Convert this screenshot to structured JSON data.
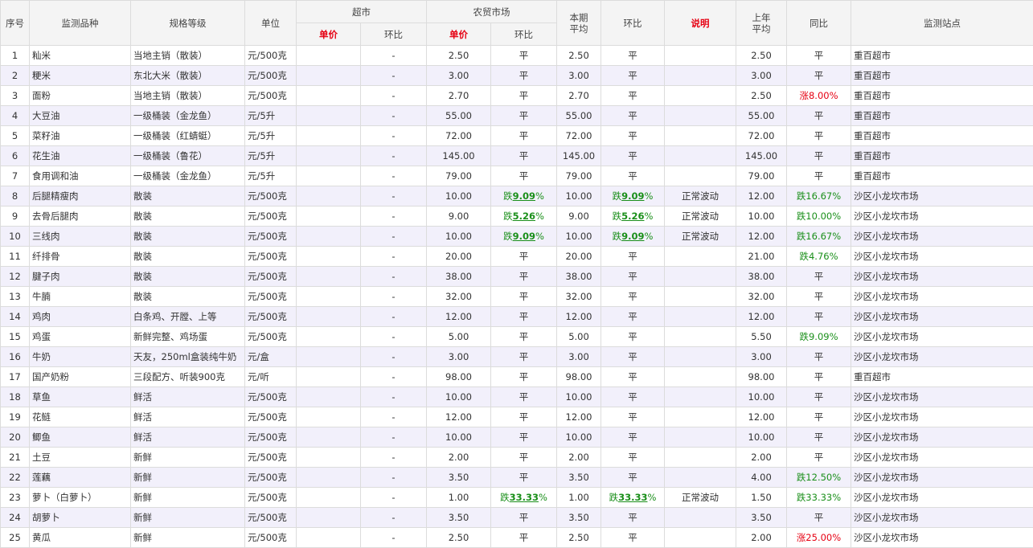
{
  "header": {
    "no": "序号",
    "variety": "监测品种",
    "spec": "规格等级",
    "unit": "单位",
    "supermarket": "超市",
    "farmers_market": "农贸市场",
    "avg_line1": "本期",
    "avg_line2": "平均",
    "mom": "环比",
    "note": "说明",
    "last_line1": "上年",
    "last_line2": "平均",
    "yoy": "同比",
    "station": "监测站点",
    "price": "单价",
    "change": "环比"
  },
  "rows": [
    {
      "no": "1",
      "name": "籼米",
      "spec": "当地主销（散装）",
      "unit": "元/500克",
      "sp": "",
      "sc": "-",
      "fp": "2.50",
      "fc": {
        "text": "平"
      },
      "avg": "2.50",
      "mom": {
        "text": "平"
      },
      "note": "",
      "last": "2.50",
      "yoy": {
        "text": "平"
      },
      "station": "重百超市"
    },
    {
      "no": "2",
      "name": "粳米",
      "spec": "东北大米（散装）",
      "unit": "元/500克",
      "sp": "",
      "sc": "-",
      "fp": "3.00",
      "fc": {
        "text": "平"
      },
      "avg": "3.00",
      "mom": {
        "text": "平"
      },
      "note": "",
      "last": "3.00",
      "yoy": {
        "text": "平"
      },
      "station": "重百超市"
    },
    {
      "no": "3",
      "name": "面粉",
      "spec": "当地主销（散装）",
      "unit": "元/500克",
      "sp": "",
      "sc": "-",
      "fp": "2.70",
      "fc": {
        "text": "平"
      },
      "avg": "2.70",
      "mom": {
        "text": "平"
      },
      "note": "",
      "last": "2.50",
      "yoy": {
        "dir": "up",
        "text": "涨8.00%"
      },
      "station": "重百超市"
    },
    {
      "no": "4",
      "name": "大豆油",
      "spec": "一级桶装（金龙鱼）",
      "unit": "元/5升",
      "sp": "",
      "sc": "-",
      "fp": "55.00",
      "fc": {
        "text": "平"
      },
      "avg": "55.00",
      "mom": {
        "text": "平"
      },
      "note": "",
      "last": "55.00",
      "yoy": {
        "text": "平"
      },
      "station": "重百超市"
    },
    {
      "no": "5",
      "name": "菜籽油",
      "spec": "一级桶装（红蜻蜓）",
      "unit": "元/5升",
      "sp": "",
      "sc": "-",
      "fp": "72.00",
      "fc": {
        "text": "平"
      },
      "avg": "72.00",
      "mom": {
        "text": "平"
      },
      "note": "",
      "last": "72.00",
      "yoy": {
        "text": "平"
      },
      "station": "重百超市"
    },
    {
      "no": "6",
      "name": "花生油",
      "spec": "一级桶装（鲁花）",
      "unit": "元/5升",
      "sp": "",
      "sc": "-",
      "fp": "145.00",
      "fc": {
        "text": "平"
      },
      "avg": "145.00",
      "mom": {
        "text": "平"
      },
      "note": "",
      "last": "145.00",
      "yoy": {
        "text": "平"
      },
      "station": "重百超市"
    },
    {
      "no": "7",
      "name": "食用调和油",
      "spec": "一级桶装（金龙鱼）",
      "unit": "元/5升",
      "sp": "",
      "sc": "-",
      "fp": "79.00",
      "fc": {
        "text": "平"
      },
      "avg": "79.00",
      "mom": {
        "text": "平"
      },
      "note": "",
      "last": "79.00",
      "yoy": {
        "text": "平"
      },
      "station": "重百超市"
    },
    {
      "no": "8",
      "name": "后腿精瘦肉",
      "spec": "散装",
      "unit": "元/500克",
      "sp": "",
      "sc": "-",
      "fp": "10.00",
      "fc": {
        "dir": "down",
        "pre": "跌",
        "num": "9.09",
        "post": "%"
      },
      "avg": "10.00",
      "mom": {
        "dir": "down",
        "pre": "跌",
        "num": "9.09",
        "post": "%"
      },
      "note": "正常波动",
      "last": "12.00",
      "yoy": {
        "dir": "down",
        "text": "跌16.67%"
      },
      "station": "沙区小龙坎市场"
    },
    {
      "no": "9",
      "name": "去骨后腿肉",
      "spec": "散装",
      "unit": "元/500克",
      "sp": "",
      "sc": "-",
      "fp": "9.00",
      "fc": {
        "dir": "down",
        "pre": "跌",
        "num": "5.26",
        "post": "%"
      },
      "avg": "9.00",
      "mom": {
        "dir": "down",
        "pre": "跌",
        "num": "5.26",
        "post": "%"
      },
      "note": "正常波动",
      "last": "10.00",
      "yoy": {
        "dir": "down",
        "text": "跌10.00%"
      },
      "station": "沙区小龙坎市场"
    },
    {
      "no": "10",
      "name": "三线肉",
      "spec": "散装",
      "unit": "元/500克",
      "sp": "",
      "sc": "-",
      "fp": "10.00",
      "fc": {
        "dir": "down",
        "pre": "跌",
        "num": "9.09",
        "post": "%"
      },
      "avg": "10.00",
      "mom": {
        "dir": "down",
        "pre": "跌",
        "num": "9.09",
        "post": "%"
      },
      "note": "正常波动",
      "last": "12.00",
      "yoy": {
        "dir": "down",
        "text": "跌16.67%"
      },
      "station": "沙区小龙坎市场"
    },
    {
      "no": "11",
      "name": "纤排骨",
      "spec": "散装",
      "unit": "元/500克",
      "sp": "",
      "sc": "-",
      "fp": "20.00",
      "fc": {
        "text": "平"
      },
      "avg": "20.00",
      "mom": {
        "text": "平"
      },
      "note": "",
      "last": "21.00",
      "yoy": {
        "dir": "down",
        "text": "跌4.76%"
      },
      "station": "沙区小龙坎市场"
    },
    {
      "no": "12",
      "name": "腱子肉",
      "spec": "散装",
      "unit": "元/500克",
      "sp": "",
      "sc": "-",
      "fp": "38.00",
      "fc": {
        "text": "平"
      },
      "avg": "38.00",
      "mom": {
        "text": "平"
      },
      "note": "",
      "last": "38.00",
      "yoy": {
        "text": "平"
      },
      "station": "沙区小龙坎市场"
    },
    {
      "no": "13",
      "name": "牛腩",
      "spec": "散装",
      "unit": "元/500克",
      "sp": "",
      "sc": "-",
      "fp": "32.00",
      "fc": {
        "text": "平"
      },
      "avg": "32.00",
      "mom": {
        "text": "平"
      },
      "note": "",
      "last": "32.00",
      "yoy": {
        "text": "平"
      },
      "station": "沙区小龙坎市场"
    },
    {
      "no": "14",
      "name": "鸡肉",
      "spec": "白条鸡、开膛、上等",
      "unit": "元/500克",
      "sp": "",
      "sc": "-",
      "fp": "12.00",
      "fc": {
        "text": "平"
      },
      "avg": "12.00",
      "mom": {
        "text": "平"
      },
      "note": "",
      "last": "12.00",
      "yoy": {
        "text": "平"
      },
      "station": "沙区小龙坎市场"
    },
    {
      "no": "15",
      "name": "鸡蛋",
      "spec": "新鲜完整、鸡场蛋",
      "unit": "元/500克",
      "sp": "",
      "sc": "-",
      "fp": "5.00",
      "fc": {
        "text": "平"
      },
      "avg": "5.00",
      "mom": {
        "text": "平"
      },
      "note": "",
      "last": "5.50",
      "yoy": {
        "dir": "down",
        "text": "跌9.09%"
      },
      "station": "沙区小龙坎市场"
    },
    {
      "no": "16",
      "name": "牛奶",
      "spec": "天友，250ml盒装纯牛奶",
      "unit": "元/盒",
      "sp": "",
      "sc": "-",
      "fp": "3.00",
      "fc": {
        "text": "平"
      },
      "avg": "3.00",
      "mom": {
        "text": "平"
      },
      "note": "",
      "last": "3.00",
      "yoy": {
        "text": "平"
      },
      "station": "沙区小龙坎市场"
    },
    {
      "no": "17",
      "name": "国产奶粉",
      "spec": "三段配方、听装900克",
      "unit": "元/听",
      "sp": "",
      "sc": "-",
      "fp": "98.00",
      "fc": {
        "text": "平"
      },
      "avg": "98.00",
      "mom": {
        "text": "平"
      },
      "note": "",
      "last": "98.00",
      "yoy": {
        "text": "平"
      },
      "station": "重百超市"
    },
    {
      "no": "18",
      "name": "草鱼",
      "spec": "鲜活",
      "unit": "元/500克",
      "sp": "",
      "sc": "-",
      "fp": "10.00",
      "fc": {
        "text": "平"
      },
      "avg": "10.00",
      "mom": {
        "text": "平"
      },
      "note": "",
      "last": "10.00",
      "yoy": {
        "text": "平"
      },
      "station": "沙区小龙坎市场"
    },
    {
      "no": "19",
      "name": "花鲢",
      "spec": "鲜活",
      "unit": "元/500克",
      "sp": "",
      "sc": "-",
      "fp": "12.00",
      "fc": {
        "text": "平"
      },
      "avg": "12.00",
      "mom": {
        "text": "平"
      },
      "note": "",
      "last": "12.00",
      "yoy": {
        "text": "平"
      },
      "station": "沙区小龙坎市场"
    },
    {
      "no": "20",
      "name": "鲫鱼",
      "spec": "鲜活",
      "unit": "元/500克",
      "sp": "",
      "sc": "-",
      "fp": "10.00",
      "fc": {
        "text": "平"
      },
      "avg": "10.00",
      "mom": {
        "text": "平"
      },
      "note": "",
      "last": "10.00",
      "yoy": {
        "text": "平"
      },
      "station": "沙区小龙坎市场"
    },
    {
      "no": "21",
      "name": "土豆",
      "spec": "新鲜",
      "unit": "元/500克",
      "sp": "",
      "sc": "-",
      "fp": "2.00",
      "fc": {
        "text": "平"
      },
      "avg": "2.00",
      "mom": {
        "text": "平"
      },
      "note": "",
      "last": "2.00",
      "yoy": {
        "text": "平"
      },
      "station": "沙区小龙坎市场"
    },
    {
      "no": "22",
      "name": "莲藕",
      "spec": "新鲜",
      "unit": "元/500克",
      "sp": "",
      "sc": "-",
      "fp": "3.50",
      "fc": {
        "text": "平"
      },
      "avg": "3.50",
      "mom": {
        "text": "平"
      },
      "note": "",
      "last": "4.00",
      "yoy": {
        "dir": "down",
        "text": "跌12.50%"
      },
      "station": "沙区小龙坎市场"
    },
    {
      "no": "23",
      "name": "萝卜（白萝卜）",
      "spec": "新鲜",
      "unit": "元/500克",
      "sp": "",
      "sc": "-",
      "fp": "1.00",
      "fc": {
        "dir": "down",
        "pre": "跌",
        "num": "33.33",
        "post": "%"
      },
      "avg": "1.00",
      "mom": {
        "dir": "down",
        "pre": "跌",
        "num": "33.33",
        "post": "%"
      },
      "note": "正常波动",
      "last": "1.50",
      "yoy": {
        "dir": "down",
        "text": "跌33.33%"
      },
      "station": "沙区小龙坎市场"
    },
    {
      "no": "24",
      "name": "胡萝卜",
      "spec": "新鲜",
      "unit": "元/500克",
      "sp": "",
      "sc": "-",
      "fp": "3.50",
      "fc": {
        "text": "平"
      },
      "avg": "3.50",
      "mom": {
        "text": "平"
      },
      "note": "",
      "last": "3.50",
      "yoy": {
        "text": "平"
      },
      "station": "沙区小龙坎市场"
    },
    {
      "no": "25",
      "name": "黄瓜",
      "spec": "新鲜",
      "unit": "元/500克",
      "sp": "",
      "sc": "-",
      "fp": "2.50",
      "fc": {
        "text": "平"
      },
      "avg": "2.50",
      "mom": {
        "text": "平"
      },
      "note": "",
      "last": "2.00",
      "yoy": {
        "dir": "up",
        "text": "涨25.00%"
      },
      "station": "沙区小龙坎市场"
    }
  ]
}
